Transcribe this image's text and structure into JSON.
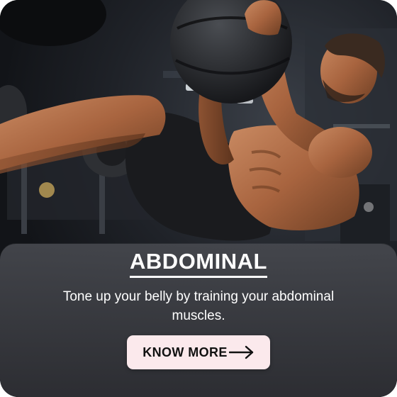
{
  "card": {
    "title": "ABDOMINAL",
    "description": "Tone up your belly by training your abdominal muscles.",
    "cta_label": "KNOW MORE",
    "cta_icon": "arrow-right-icon",
    "photo_alt": "athlete-training-with-medicine-ball"
  },
  "colors": {
    "overlay": "#3c3d42",
    "button_bg": "#fbe9ec",
    "button_text": "#111111",
    "text": "#ffffff"
  }
}
